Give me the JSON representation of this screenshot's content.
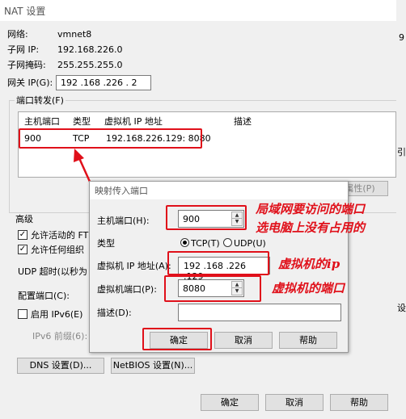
{
  "title": "NAT 设置",
  "network": {
    "network_label": "网络:",
    "network_value": "vmnet8",
    "subnet_ip_label": "子网 IP:",
    "subnet_ip_value": "192.168.226.0",
    "subnet_mask_label": "子网掩码:",
    "subnet_mask_value": "255.255.255.0",
    "gateway_label": "网关 IP(G):",
    "gateway_value": "192 .168 .226 . 2"
  },
  "port_forwarding": {
    "group_label": "端口转发(F)",
    "columns": [
      "主机端口",
      "类型",
      "虚拟机 IP 地址",
      "描述"
    ],
    "rows": [
      {
        "host_port": "900",
        "type": "TCP",
        "vm_addr": "192.168.226.129: 8080",
        "desc": ""
      }
    ],
    "properties_button": "属性(P)"
  },
  "advanced": {
    "label": "高级",
    "allow_ftp": "允许活动的 FT",
    "allow_org": "允许任何组织",
    "udp_timeout": "UDP 超时(以秒为",
    "config_port": "配置端口(C):",
    "enable_ipv6": "启用 IPv6(E)",
    "ipv6_prefix": "IPv6 前缀(6):"
  },
  "bottom_buttons": {
    "dns": "DNS 设置(D)...",
    "netbios": "NetBIOS 设置(N)...",
    "ok": "确定",
    "cancel": "取消",
    "help": "帮助"
  },
  "right_edge_fragments": {
    "a": "9",
    "b": "引",
    "c": "设"
  },
  "sub_dialog": {
    "title": "映射传入端口",
    "host_port_label": "主机端口(H):",
    "host_port_value": "900",
    "type_label": "类型",
    "tcp_label": "TCP(T)",
    "udp_label": "UDP(U)",
    "tcp_selected": true,
    "vm_ip_label": "虚拟机 IP 地址(A):",
    "vm_ip_value": "192 .168 .226 .129",
    "vm_port_label": "虚拟机端口(P):",
    "vm_port_value": "8080",
    "desc_label": "描述(D):",
    "desc_value": "",
    "ok": "确定",
    "cancel": "取消",
    "help": "帮助"
  },
  "annotations": {
    "host_port_note_1": "局域网要访问的端口",
    "host_port_note_2": "选电脑上没有占用的",
    "vm_ip_note": "虚拟机的ip",
    "vm_port_note": "虚拟机的端口"
  },
  "colors": {
    "annotation": "#e0101a",
    "dialog_bg": "#f0f0f0"
  }
}
